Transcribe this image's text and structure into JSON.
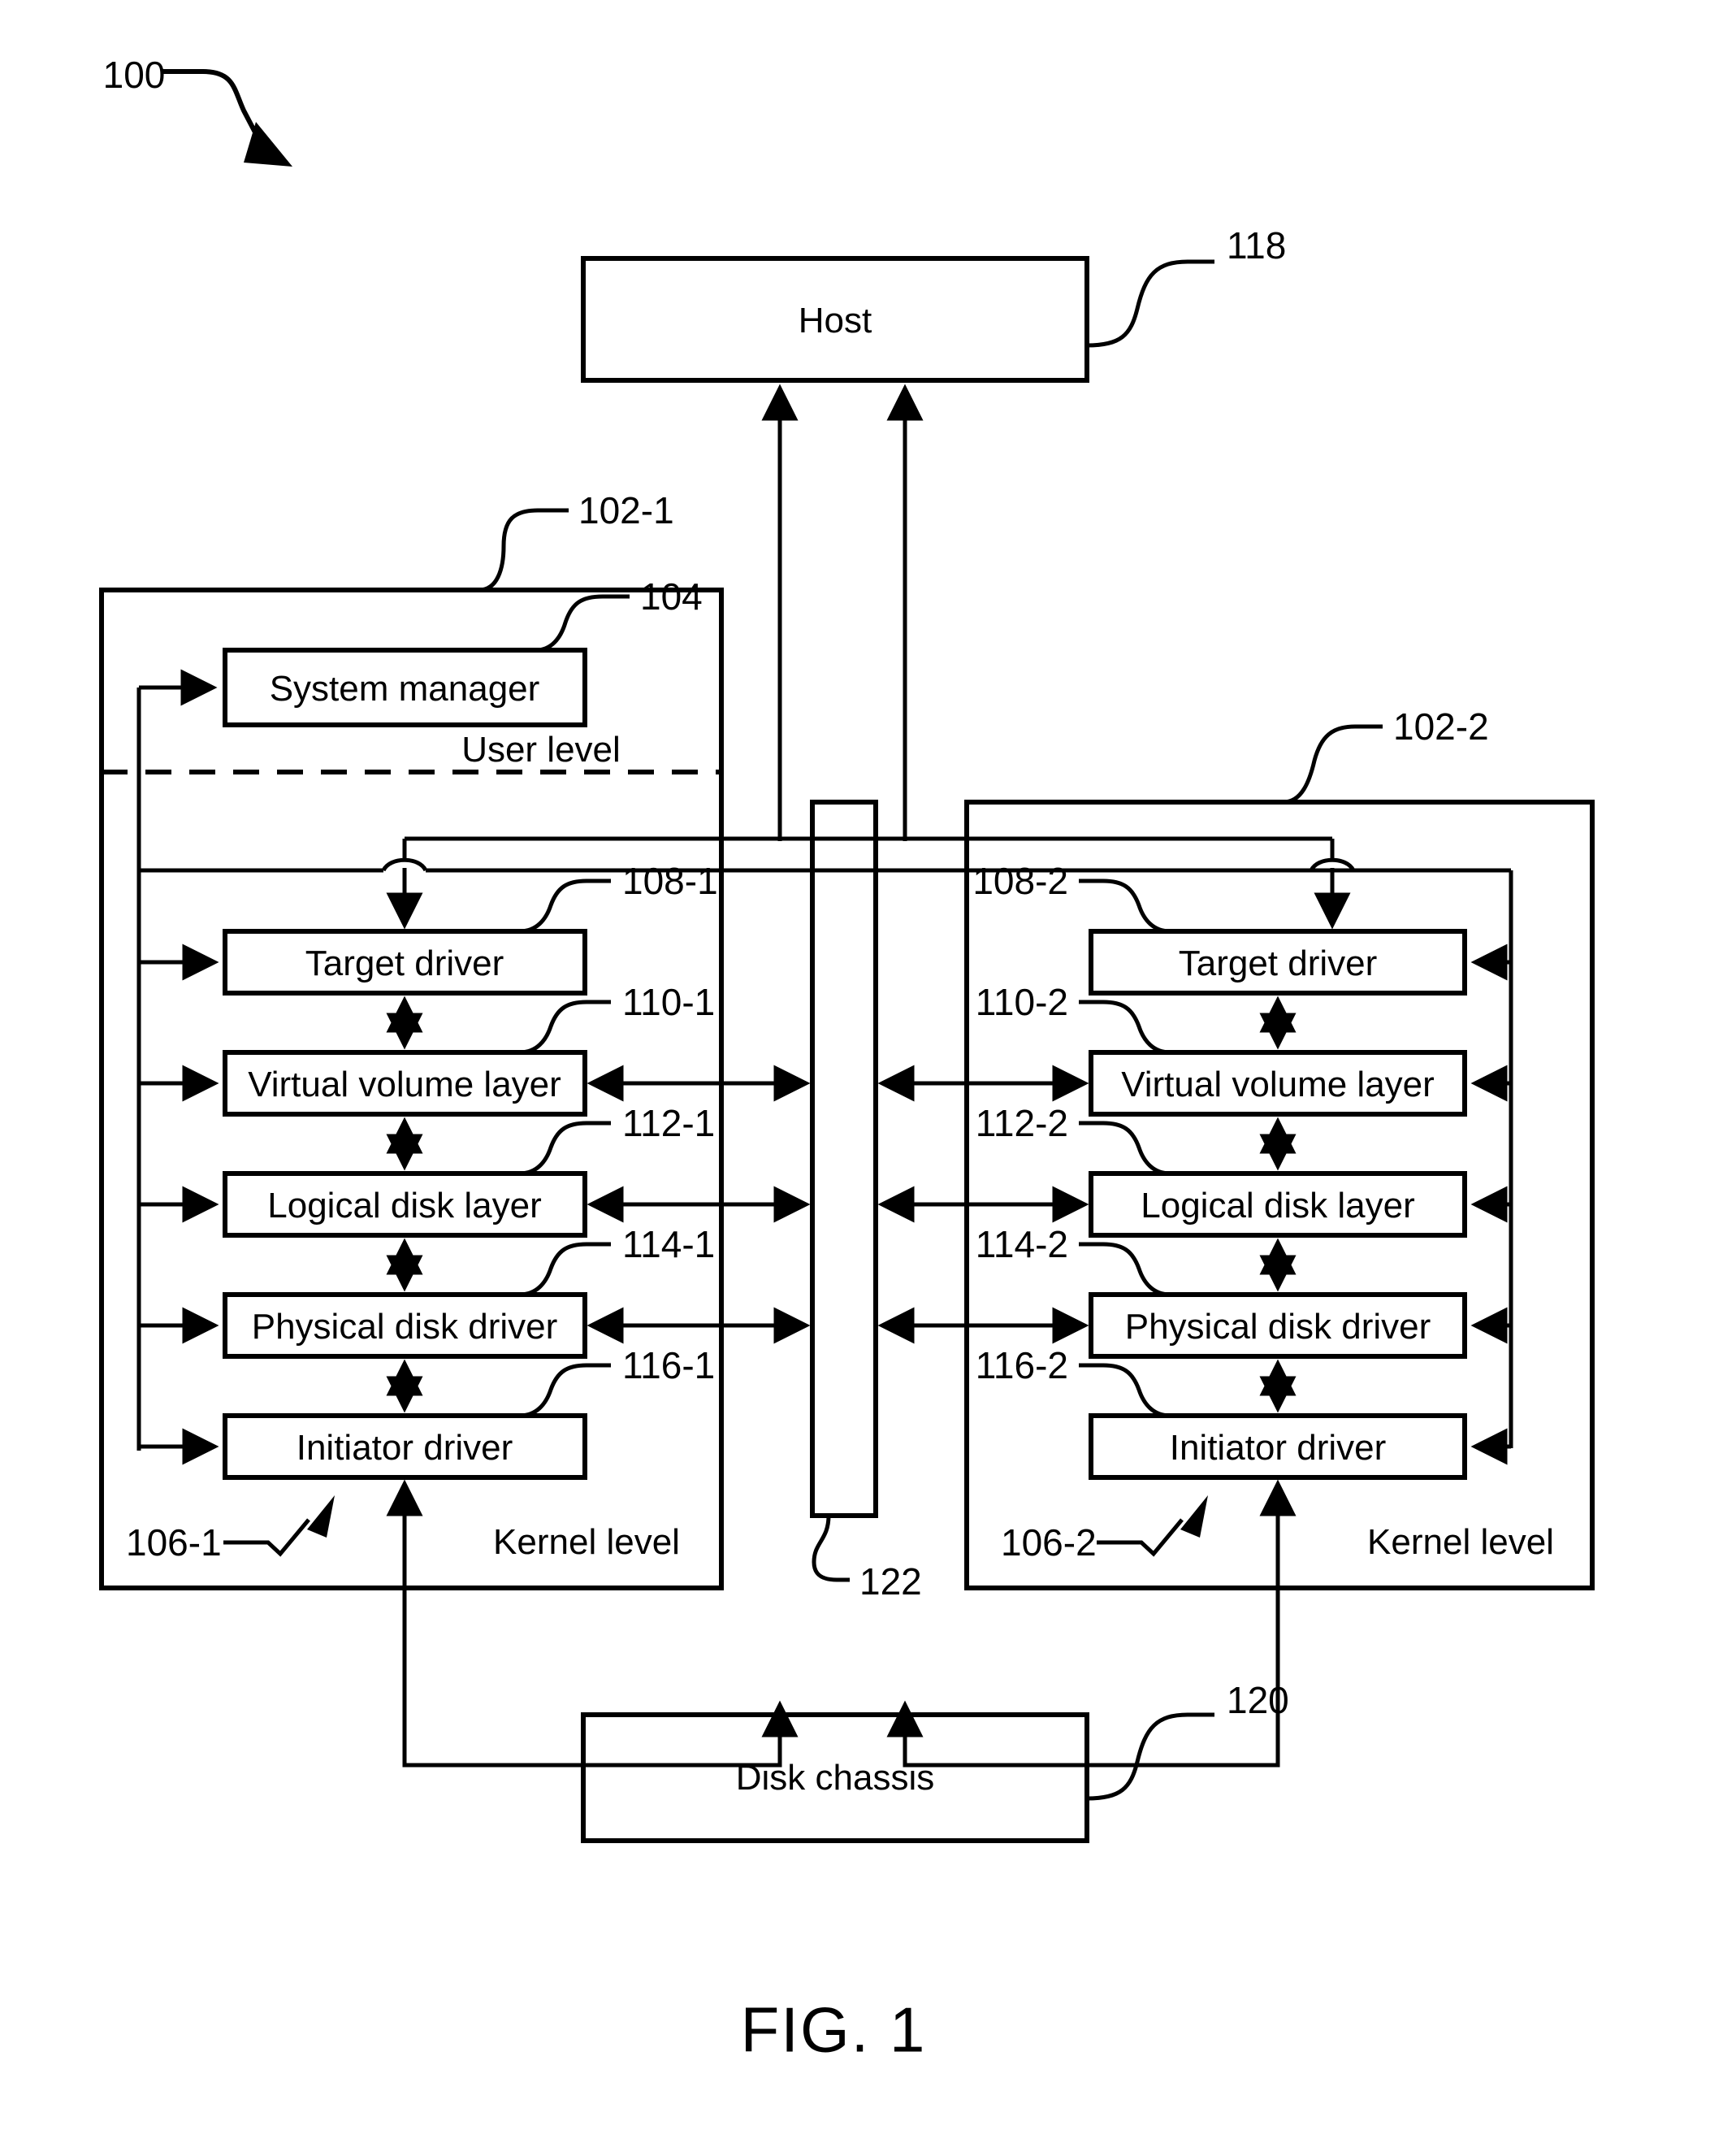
{
  "figure": {
    "caption": "FIG. 1",
    "root_ref": "100"
  },
  "nodes": {
    "host": {
      "label": "Host",
      "ref": "118"
    },
    "disk_chassis": {
      "label": "Disk chassis",
      "ref": "120"
    },
    "interconnect": {
      "label": "",
      "ref": "122"
    },
    "system_manager": {
      "label": "System manager",
      "ref": "104"
    }
  },
  "controllers": [
    {
      "ref": "102-1",
      "user_level_label": "User level",
      "kernel_level_label": "Kernel level",
      "kernel_ref": "106-1",
      "layers": [
        {
          "label": "Target driver",
          "ref": "108-1"
        },
        {
          "label": "Virtual volume layer",
          "ref": "110-1"
        },
        {
          "label": "Logical disk layer",
          "ref": "112-1"
        },
        {
          "label": "Physical disk driver",
          "ref": "114-1"
        },
        {
          "label": "Initiator driver",
          "ref": "116-1"
        }
      ]
    },
    {
      "ref": "102-2",
      "user_level_label": "",
      "kernel_level_label": "Kernel level",
      "kernel_ref": "106-2",
      "layers": [
        {
          "label": "Target driver",
          "ref": "108-2"
        },
        {
          "label": "Virtual volume layer",
          "ref": "110-2"
        },
        {
          "label": "Logical disk layer",
          "ref": "112-2"
        },
        {
          "label": "Physical disk driver",
          "ref": "114-2"
        },
        {
          "label": "Initiator driver",
          "ref": "116-2"
        }
      ]
    }
  ],
  "colors": {
    "ink": "#000000",
    "paper": "#ffffff"
  }
}
